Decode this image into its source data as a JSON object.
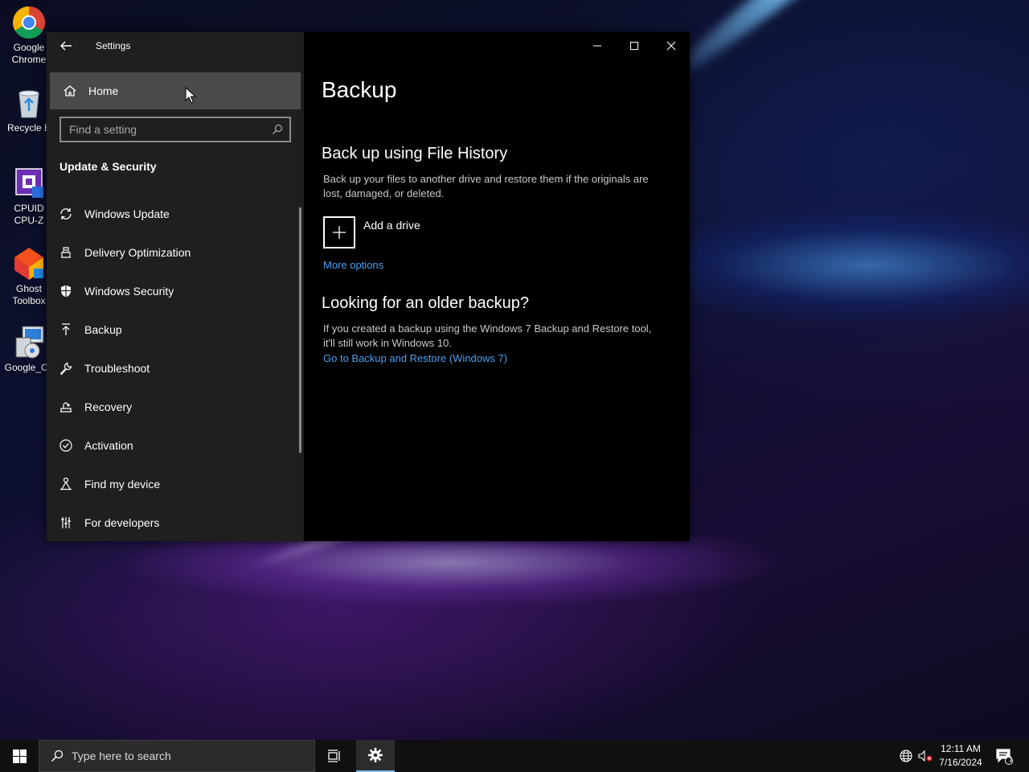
{
  "desktop": {
    "icons": [
      {
        "label": "Google\nChrome",
        "icon": "chrome-icon"
      },
      {
        "label": "Recycle B",
        "icon": "recycle-bin-icon"
      },
      {
        "label": "CPUID\nCPU-Z",
        "icon": "cpu-z-icon"
      },
      {
        "label": "Ghost\nToolbox",
        "icon": "ghost-toolbox-icon"
      },
      {
        "label": "Google_Ch",
        "icon": "installer-icon"
      }
    ]
  },
  "window": {
    "title": "Settings",
    "controls": {
      "minimize": "minimize-icon",
      "maximize": "maximize-icon",
      "close": "close-icon"
    }
  },
  "sidebar": {
    "home_label": "Home",
    "search_placeholder": "Find a setting",
    "section_title": "Update & Security",
    "items": [
      {
        "label": "Windows Update",
        "icon": "refresh-icon"
      },
      {
        "label": "Delivery Optimization",
        "icon": "delivery-optimization-icon"
      },
      {
        "label": "Windows Security",
        "icon": "shield-icon"
      },
      {
        "label": "Backup",
        "icon": "upload-arrow-icon"
      },
      {
        "label": "Troubleshoot",
        "icon": "wrench-icon"
      },
      {
        "label": "Recovery",
        "icon": "recovery-icon"
      },
      {
        "label": "Activation",
        "icon": "check-circle-icon"
      },
      {
        "label": "Find my device",
        "icon": "find-device-icon"
      },
      {
        "label": "For developers",
        "icon": "developer-tools-icon"
      }
    ],
    "selected_index": 3
  },
  "content": {
    "page_title": "Backup",
    "file_history": {
      "heading": "Back up using File History",
      "description": "Back up your files to another drive and restore them if the originals are lost, damaged, or deleted.",
      "add_drive_label": "Add a drive",
      "more_options_link": "More options"
    },
    "older_backup": {
      "heading": "Looking for an older backup?",
      "description": "If you created a backup using the Windows 7 Backup and Restore tool, it'll still work in Windows 10.",
      "link": "Go to Backup and Restore (Windows 7)"
    }
  },
  "taskbar": {
    "search_placeholder": "Type here to search",
    "time": "12:11 AM",
    "date": "7/16/2024",
    "notification_count": "1"
  },
  "colors": {
    "accent": "#76b9ed",
    "link": "#4aa0f0",
    "sidebar_bg": "#1f1f1f",
    "content_bg": "#000000"
  }
}
